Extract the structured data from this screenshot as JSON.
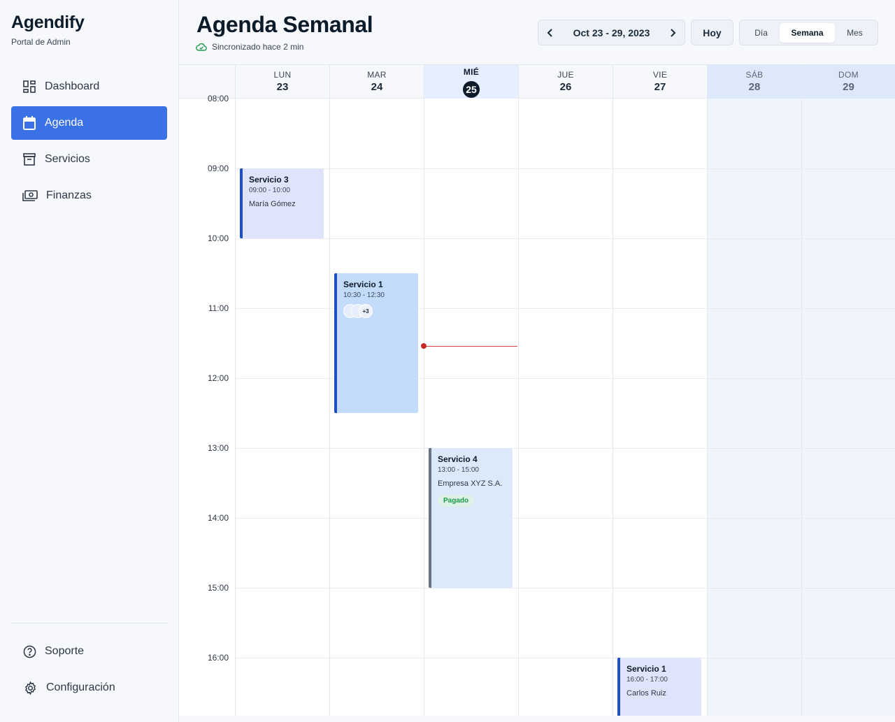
{
  "sidebar": {
    "brand": "Agendify",
    "subtitle": "Portal de Admin",
    "items": [
      {
        "label": "Dashboard",
        "icon": "dashboard-icon"
      },
      {
        "label": "Agenda",
        "icon": "calendar-icon",
        "active": true
      },
      {
        "label": "Servicios",
        "icon": "archive-icon"
      },
      {
        "label": "Finanzas",
        "icon": "cash-icon"
      }
    ],
    "footer": [
      {
        "label": "Soporte",
        "icon": "help-icon"
      },
      {
        "label": "Configuración",
        "icon": "gear-icon"
      }
    ]
  },
  "header": {
    "title": "Agenda Semanal",
    "sync_status": "Sincronizado hace 2 min",
    "date_range": "Oct 23 - 29, 2023",
    "today_label": "Hoy",
    "views": [
      "Día",
      "Semana",
      "Mes"
    ],
    "selected_view": "Semana"
  },
  "calendar": {
    "days": [
      {
        "name": "LUN",
        "num": "23"
      },
      {
        "name": "MAR",
        "num": "24"
      },
      {
        "name": "MIÉ",
        "num": "25",
        "today": true
      },
      {
        "name": "JUE",
        "num": "26"
      },
      {
        "name": "VIE",
        "num": "27"
      },
      {
        "name": "SÁB",
        "num": "28",
        "weekend": true
      },
      {
        "name": "DOM",
        "num": "29",
        "weekend": true
      }
    ],
    "hours": [
      "08:00",
      "09:00",
      "10:00",
      "11:00",
      "12:00",
      "13:00",
      "14:00",
      "15:00",
      "16:00"
    ],
    "events": [
      {
        "title": "Servicio 3",
        "time": "09:00 - 10:00",
        "client": "María Gómez"
      },
      {
        "title": "Servicio 1",
        "time": "10:30 - 12:30",
        "extra_attendees": "+3"
      },
      {
        "title": "Servicio 4",
        "time": "13:00 - 15:00",
        "client": "Empresa XYZ S.A.",
        "status": "Pagado"
      },
      {
        "title": "Servicio 1",
        "time": "16:00 - 17:00",
        "client": "Carlos Ruiz"
      }
    ]
  },
  "colors": {
    "accent": "#3a72e6",
    "event_border": "#1d4fc9",
    "now_indicator": "#c62828",
    "paid_badge": "#1c9a4b"
  }
}
